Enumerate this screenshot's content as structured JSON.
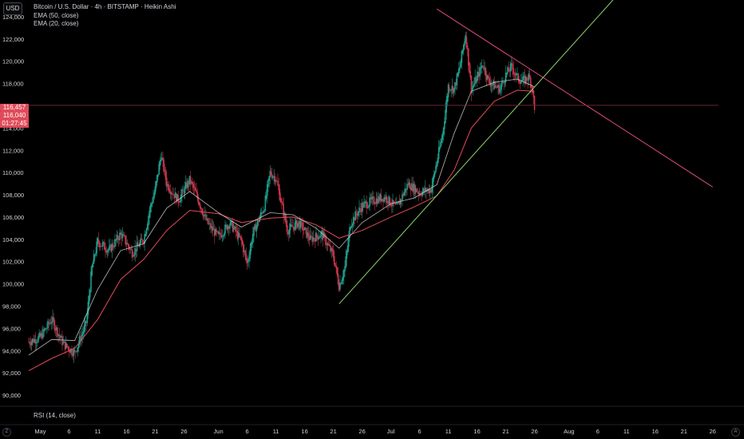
{
  "header": {
    "currency": "USD",
    "title": "Bitcoin / U.S. Dollar · 4h · BITSTAMP · Heikin Ashi",
    "indicators": [
      "EMA (50, close)",
      "EMA (20, close)"
    ]
  },
  "price_badges": {
    "upper": "116,457",
    "current": "116,040",
    "timer": "01:27:45"
  },
  "rsi": {
    "label": "RSI (14, close)"
  },
  "corner_buttons": {
    "left": "Z",
    "right": "A"
  },
  "colors": {
    "background": "#000000",
    "up_candle": "#1e9e8c",
    "down_candle": "#c8354a",
    "ema50": "#e04b5a",
    "ema20": "#d9d9d9",
    "resistance_line": "#e04b78",
    "support_line": "#8fd36f",
    "price_line": "#7a2a34",
    "axis_text": "#d1d4dc"
  },
  "chart_data": {
    "type": "line",
    "title": "Bitcoin / U.S. Dollar · 4h · BITSTAMP · Heikin Ashi",
    "ylim": [
      89000,
      125500
    ],
    "xlim": [
      "2025-04-29",
      "2025-08-27"
    ],
    "y_ticks": [
      90000,
      92000,
      94000,
      96000,
      98000,
      100000,
      102000,
      104000,
      106000,
      108000,
      110000,
      112000,
      114000,
      116000,
      118000,
      120000,
      122000,
      124000
    ],
    "y_tick_labels": [
      "90,000",
      "92,000",
      "94,000",
      "96,000",
      "98,000",
      "100,000",
      "102,000",
      "104,000",
      "106,000",
      "108,000",
      "110,000",
      "112,000",
      "114,000",
      "116,000",
      "118,000",
      "120,000",
      "122,000",
      "124,000"
    ],
    "x_ticks": [
      {
        "label": "May",
        "date": "2025-05-01"
      },
      {
        "label": "6",
        "date": "2025-05-06"
      },
      {
        "label": "11",
        "date": "2025-05-11"
      },
      {
        "label": "16",
        "date": "2025-05-16"
      },
      {
        "label": "21",
        "date": "2025-05-21"
      },
      {
        "label": "26",
        "date": "2025-05-26"
      },
      {
        "label": "Jun",
        "date": "2025-06-01"
      },
      {
        "label": "6",
        "date": "2025-06-06"
      },
      {
        "label": "11",
        "date": "2025-06-11"
      },
      {
        "label": "16",
        "date": "2025-06-16"
      },
      {
        "label": "21",
        "date": "2025-06-21"
      },
      {
        "label": "26",
        "date": "2025-06-26"
      },
      {
        "label": "Jul",
        "date": "2025-07-01"
      },
      {
        "label": "6",
        "date": "2025-07-06"
      },
      {
        "label": "11",
        "date": "2025-07-11"
      },
      {
        "label": "16",
        "date": "2025-07-16"
      },
      {
        "label": "21",
        "date": "2025-07-21"
      },
      {
        "label": "26",
        "date": "2025-07-26"
      },
      {
        "label": "Aug",
        "date": "2025-08-01"
      },
      {
        "label": "6",
        "date": "2025-08-06"
      },
      {
        "label": "11",
        "date": "2025-08-11"
      },
      {
        "label": "16",
        "date": "2025-08-16"
      },
      {
        "label": "21",
        "date": "2025-08-21"
      },
      {
        "label": "26",
        "date": "2025-08-26"
      }
    ],
    "price_series": [
      {
        "date": "2025-04-29",
        "value": 94800
      },
      {
        "date": "2025-05-01",
        "value": 95200
      },
      {
        "date": "2025-05-03",
        "value": 96800
      },
      {
        "date": "2025-05-05",
        "value": 94600
      },
      {
        "date": "2025-05-07",
        "value": 93800
      },
      {
        "date": "2025-05-09",
        "value": 96500
      },
      {
        "date": "2025-05-10",
        "value": 101500
      },
      {
        "date": "2025-05-11",
        "value": 103800
      },
      {
        "date": "2025-05-13",
        "value": 103000
      },
      {
        "date": "2025-05-15",
        "value": 104500
      },
      {
        "date": "2025-05-17",
        "value": 102800
      },
      {
        "date": "2025-05-19",
        "value": 104000
      },
      {
        "date": "2025-05-20",
        "value": 106600
      },
      {
        "date": "2025-05-21",
        "value": 108500
      },
      {
        "date": "2025-05-22",
        "value": 111600
      },
      {
        "date": "2025-05-23",
        "value": 109000
      },
      {
        "date": "2025-05-25",
        "value": 107500
      },
      {
        "date": "2025-05-27",
        "value": 109300
      },
      {
        "date": "2025-05-28",
        "value": 108200
      },
      {
        "date": "2025-05-30",
        "value": 105500
      },
      {
        "date": "2025-06-01",
        "value": 104200
      },
      {
        "date": "2025-06-03",
        "value": 105500
      },
      {
        "date": "2025-06-05",
        "value": 103800
      },
      {
        "date": "2025-06-06",
        "value": 101800
      },
      {
        "date": "2025-06-07",
        "value": 104500
      },
      {
        "date": "2025-06-09",
        "value": 107000
      },
      {
        "date": "2025-06-10",
        "value": 110000
      },
      {
        "date": "2025-06-11",
        "value": 109500
      },
      {
        "date": "2025-06-13",
        "value": 104800
      },
      {
        "date": "2025-06-15",
        "value": 105500
      },
      {
        "date": "2025-06-17",
        "value": 104000
      },
      {
        "date": "2025-06-19",
        "value": 104500
      },
      {
        "date": "2025-06-21",
        "value": 102500
      },
      {
        "date": "2025-06-22",
        "value": 99800
      },
      {
        "date": "2025-06-23",
        "value": 101500
      },
      {
        "date": "2025-06-24",
        "value": 105500
      },
      {
        "date": "2025-06-26",
        "value": 107000
      },
      {
        "date": "2025-06-28",
        "value": 107500
      },
      {
        "date": "2025-06-30",
        "value": 107800
      },
      {
        "date": "2025-07-02",
        "value": 106800
      },
      {
        "date": "2025-07-04",
        "value": 109000
      },
      {
        "date": "2025-07-06",
        "value": 108200
      },
      {
        "date": "2025-07-08",
        "value": 108500
      },
      {
        "date": "2025-07-09",
        "value": 111000
      },
      {
        "date": "2025-07-10",
        "value": 113500
      },
      {
        "date": "2025-07-11",
        "value": 117800
      },
      {
        "date": "2025-07-12",
        "value": 117500
      },
      {
        "date": "2025-07-13",
        "value": 119500
      },
      {
        "date": "2025-07-14",
        "value": 122500
      },
      {
        "date": "2025-07-15",
        "value": 117500
      },
      {
        "date": "2025-07-16",
        "value": 118500
      },
      {
        "date": "2025-07-17",
        "value": 119800
      },
      {
        "date": "2025-07-18",
        "value": 118200
      },
      {
        "date": "2025-07-19",
        "value": 117800
      },
      {
        "date": "2025-07-20",
        "value": 117500
      },
      {
        "date": "2025-07-21",
        "value": 118800
      },
      {
        "date": "2025-07-22",
        "value": 119500
      },
      {
        "date": "2025-07-23",
        "value": 118500
      },
      {
        "date": "2025-07-24",
        "value": 118200
      },
      {
        "date": "2025-07-25",
        "value": 118600
      },
      {
        "date": "2025-07-25T16:00",
        "value": 117500
      },
      {
        "date": "2025-07-26",
        "value": 115500
      }
    ],
    "ema20": [
      {
        "date": "2025-04-29",
        "value": 93600
      },
      {
        "date": "2025-05-03",
        "value": 95000
      },
      {
        "date": "2025-05-07",
        "value": 94900
      },
      {
        "date": "2025-05-11",
        "value": 99500
      },
      {
        "date": "2025-05-15",
        "value": 103000
      },
      {
        "date": "2025-05-19",
        "value": 103600
      },
      {
        "date": "2025-05-23",
        "value": 106800
      },
      {
        "date": "2025-05-27",
        "value": 108300
      },
      {
        "date": "2025-06-01",
        "value": 106400
      },
      {
        "date": "2025-06-05",
        "value": 105100
      },
      {
        "date": "2025-06-10",
        "value": 106400
      },
      {
        "date": "2025-06-14",
        "value": 106200
      },
      {
        "date": "2025-06-18",
        "value": 105000
      },
      {
        "date": "2025-06-22",
        "value": 103200
      },
      {
        "date": "2025-06-26",
        "value": 105500
      },
      {
        "date": "2025-07-01",
        "value": 107200
      },
      {
        "date": "2025-07-05",
        "value": 107700
      },
      {
        "date": "2025-07-09",
        "value": 108900
      },
      {
        "date": "2025-07-12",
        "value": 113500
      },
      {
        "date": "2025-07-15",
        "value": 117300
      },
      {
        "date": "2025-07-19",
        "value": 118100
      },
      {
        "date": "2025-07-23",
        "value": 118400
      },
      {
        "date": "2025-07-26",
        "value": 117700
      }
    ],
    "ema50": [
      {
        "date": "2025-04-29",
        "value": 92200
      },
      {
        "date": "2025-05-03",
        "value": 93300
      },
      {
        "date": "2025-05-07",
        "value": 94200
      },
      {
        "date": "2025-05-11",
        "value": 96800
      },
      {
        "date": "2025-05-15",
        "value": 100400
      },
      {
        "date": "2025-05-19",
        "value": 102200
      },
      {
        "date": "2025-05-23",
        "value": 104800
      },
      {
        "date": "2025-05-27",
        "value": 106600
      },
      {
        "date": "2025-06-01",
        "value": 106300
      },
      {
        "date": "2025-06-05",
        "value": 105500
      },
      {
        "date": "2025-06-10",
        "value": 105900
      },
      {
        "date": "2025-06-14",
        "value": 106000
      },
      {
        "date": "2025-06-18",
        "value": 105300
      },
      {
        "date": "2025-06-22",
        "value": 104100
      },
      {
        "date": "2025-06-26",
        "value": 104800
      },
      {
        "date": "2025-07-01",
        "value": 106000
      },
      {
        "date": "2025-07-05",
        "value": 106900
      },
      {
        "date": "2025-07-09",
        "value": 107900
      },
      {
        "date": "2025-07-12",
        "value": 110200
      },
      {
        "date": "2025-07-15",
        "value": 114000
      },
      {
        "date": "2025-07-19",
        "value": 116400
      },
      {
        "date": "2025-07-23",
        "value": 117400
      },
      {
        "date": "2025-07-26",
        "value": 117300
      }
    ],
    "trendlines": [
      {
        "kind": "resistance",
        "from": {
          "date": "2025-07-09",
          "value": 124700
        },
        "to": {
          "date": "2025-08-26",
          "value": 108700
        }
      },
      {
        "kind": "support",
        "from": {
          "date": "2025-06-22",
          "value": 98200
        },
        "to": {
          "date": "2025-08-13",
          "value": 128000
        }
      }
    ],
    "current_price_line": 116040,
    "grid": false,
    "legend": "top-left"
  }
}
